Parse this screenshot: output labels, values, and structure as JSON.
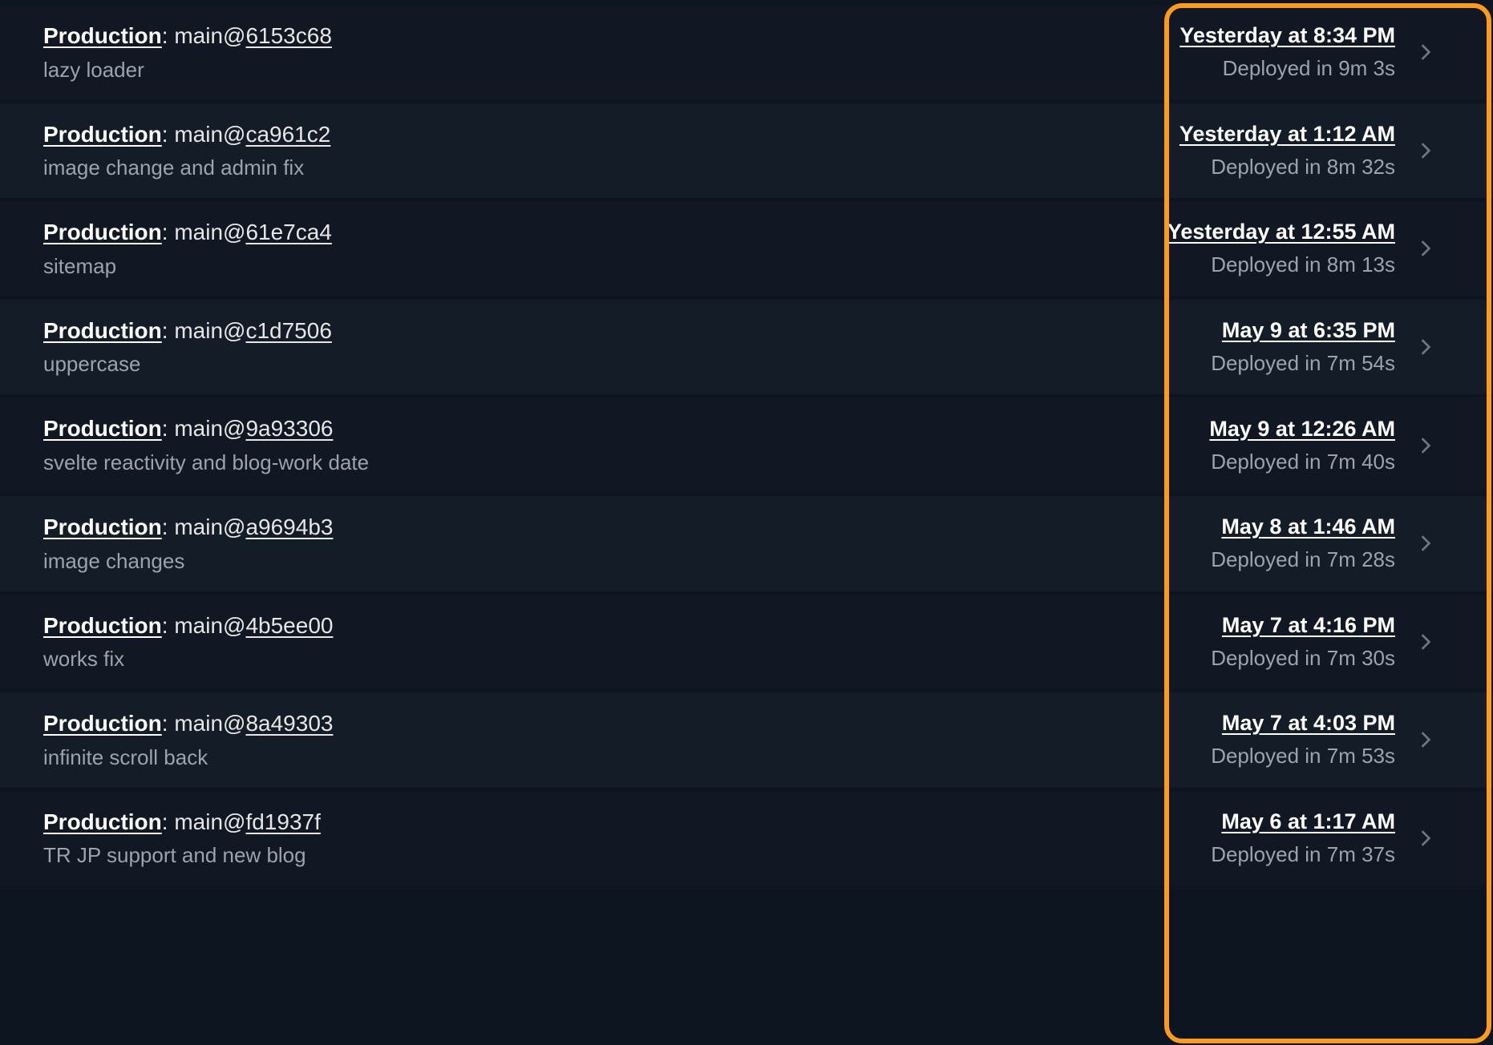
{
  "environment_label": "Production",
  "branch_prefix": "main@",
  "duration_prefix": "Deployed in ",
  "highlight_color": "#ff9b1a",
  "deployments": [
    {
      "commit": "6153c68",
      "message": "lazy loader",
      "timestamp": "Yesterday at 8:34 PM",
      "duration": "9m 3s"
    },
    {
      "commit": "ca961c2",
      "message": "image change and admin fix",
      "timestamp": "Yesterday at 1:12 AM",
      "duration": "8m 32s"
    },
    {
      "commit": "61e7ca4",
      "message": "sitemap",
      "timestamp": "Yesterday at 12:55 AM",
      "duration": "8m 13s"
    },
    {
      "commit": "c1d7506",
      "message": "uppercase",
      "timestamp": "May 9 at 6:35 PM",
      "duration": "7m 54s"
    },
    {
      "commit": "9a93306",
      "message": "svelte reactivity and blog-work date",
      "timestamp": "May 9 at 12:26 AM",
      "duration": "7m 40s"
    },
    {
      "commit": "a9694b3",
      "message": "image changes",
      "timestamp": "May 8 at 1:46 AM",
      "duration": "7m 28s"
    },
    {
      "commit": "4b5ee00",
      "message": "works fix",
      "timestamp": "May 7 at 4:16 PM",
      "duration": "7m 30s"
    },
    {
      "commit": "8a49303",
      "message": "infinite scroll back",
      "timestamp": "May 7 at 4:03 PM",
      "duration": "7m 53s"
    },
    {
      "commit": "fd1937f",
      "message": "TR JP support and new blog",
      "timestamp": "May 6 at 1:17 AM",
      "duration": "7m 37s"
    }
  ]
}
